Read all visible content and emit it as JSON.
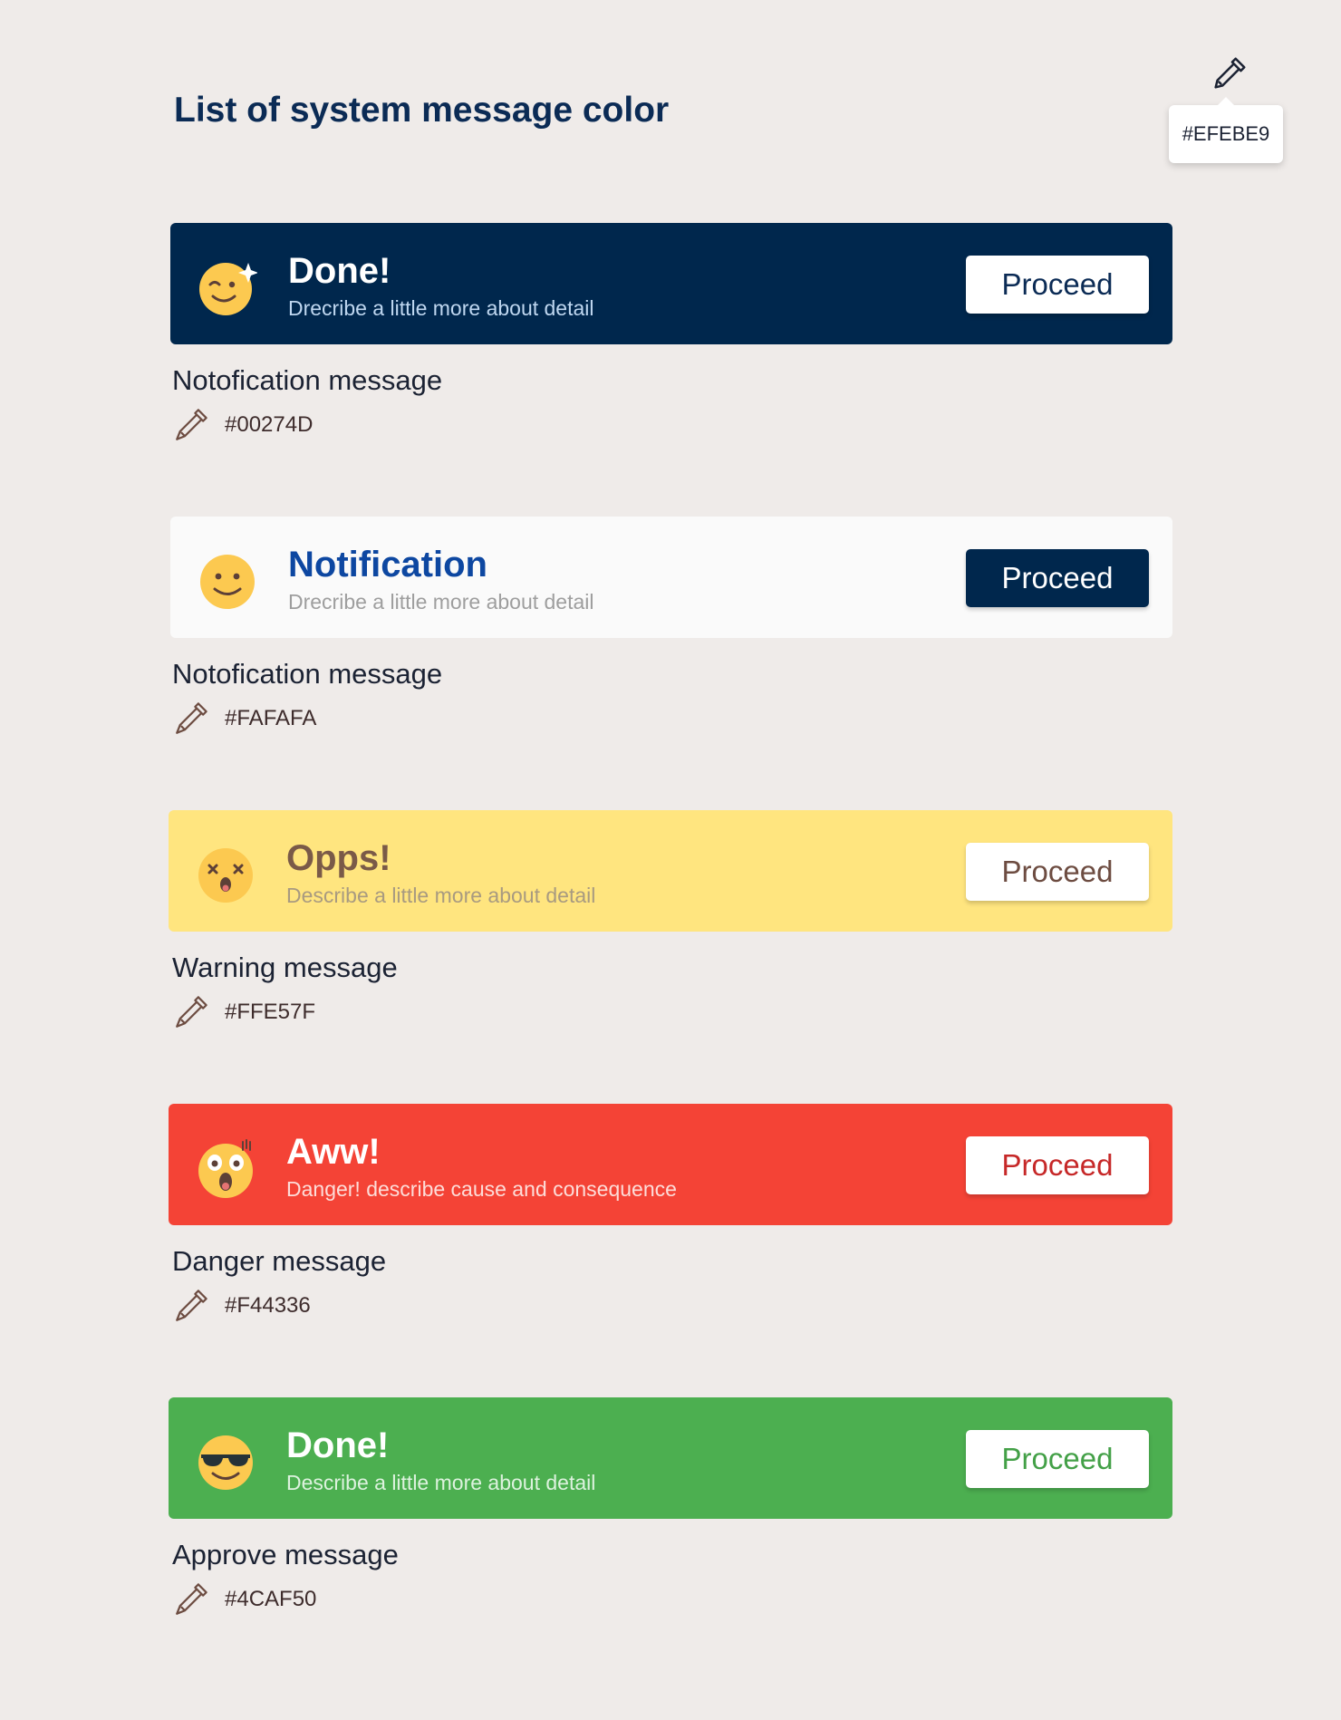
{
  "page_title": "List of system message color",
  "picker": {
    "icon": "eyedropper-icon",
    "hex": "#EFEBE9"
  },
  "cards": [
    {
      "title": "Done!",
      "subtitle": "Drecribe a little more about detail",
      "button": "Proceed",
      "label": "Notofication message",
      "hex": "#00274D",
      "emoji": "wink-sparkle-emoji",
      "bg": "#00274D",
      "title_color": "#FFFFFF",
      "sub_color": "#BFD7F0",
      "btn_bg": "#FFFFFF",
      "btn_color": "#0B2B55"
    },
    {
      "title": "Notification",
      "subtitle": "Drecribe a little more about detail",
      "button": "Proceed",
      "label": "Notofication message",
      "hex": "#FAFAFA",
      "emoji": "smile-emoji",
      "bg": "#FAFAFA",
      "title_color": "#0D47A1",
      "sub_color": "#9E9E9E",
      "btn_bg": "#00274D",
      "btn_color": "#FFFFFF"
    },
    {
      "title": "Opps!",
      "subtitle": "Describe a little more about detail",
      "button": "Proceed",
      "label": "Warning message",
      "hex": "#FFE57F",
      "emoji": "dizzy-face-emoji",
      "bg": "#FFE57F",
      "title_color": "#7A5A48",
      "sub_color": "#A89A80",
      "btn_bg": "#FFFFFF",
      "btn_color": "#6D4C41"
    },
    {
      "title": "Aww!",
      "subtitle": "Danger! describe cause and consequence",
      "button": "Proceed",
      "label": "Danger message",
      "hex": "#F44336",
      "emoji": "shocked-face-emoji",
      "bg": "#F44336",
      "title_color": "#FFFFFF",
      "sub_color": "#FDDDD9",
      "btn_bg": "#FFFFFF",
      "btn_color": "#C62828"
    },
    {
      "title": "Done!",
      "subtitle": "Describe a little more about detail",
      "button": "Proceed",
      "label": "Approve message",
      "hex": "#4CAF50",
      "emoji": "sunglasses-emoji",
      "bg": "#4CAF50",
      "title_color": "#FFFFFF",
      "sub_color": "#DDF2DE",
      "btn_bg": "#FFFFFF",
      "btn_color": "#43A047"
    }
  ]
}
